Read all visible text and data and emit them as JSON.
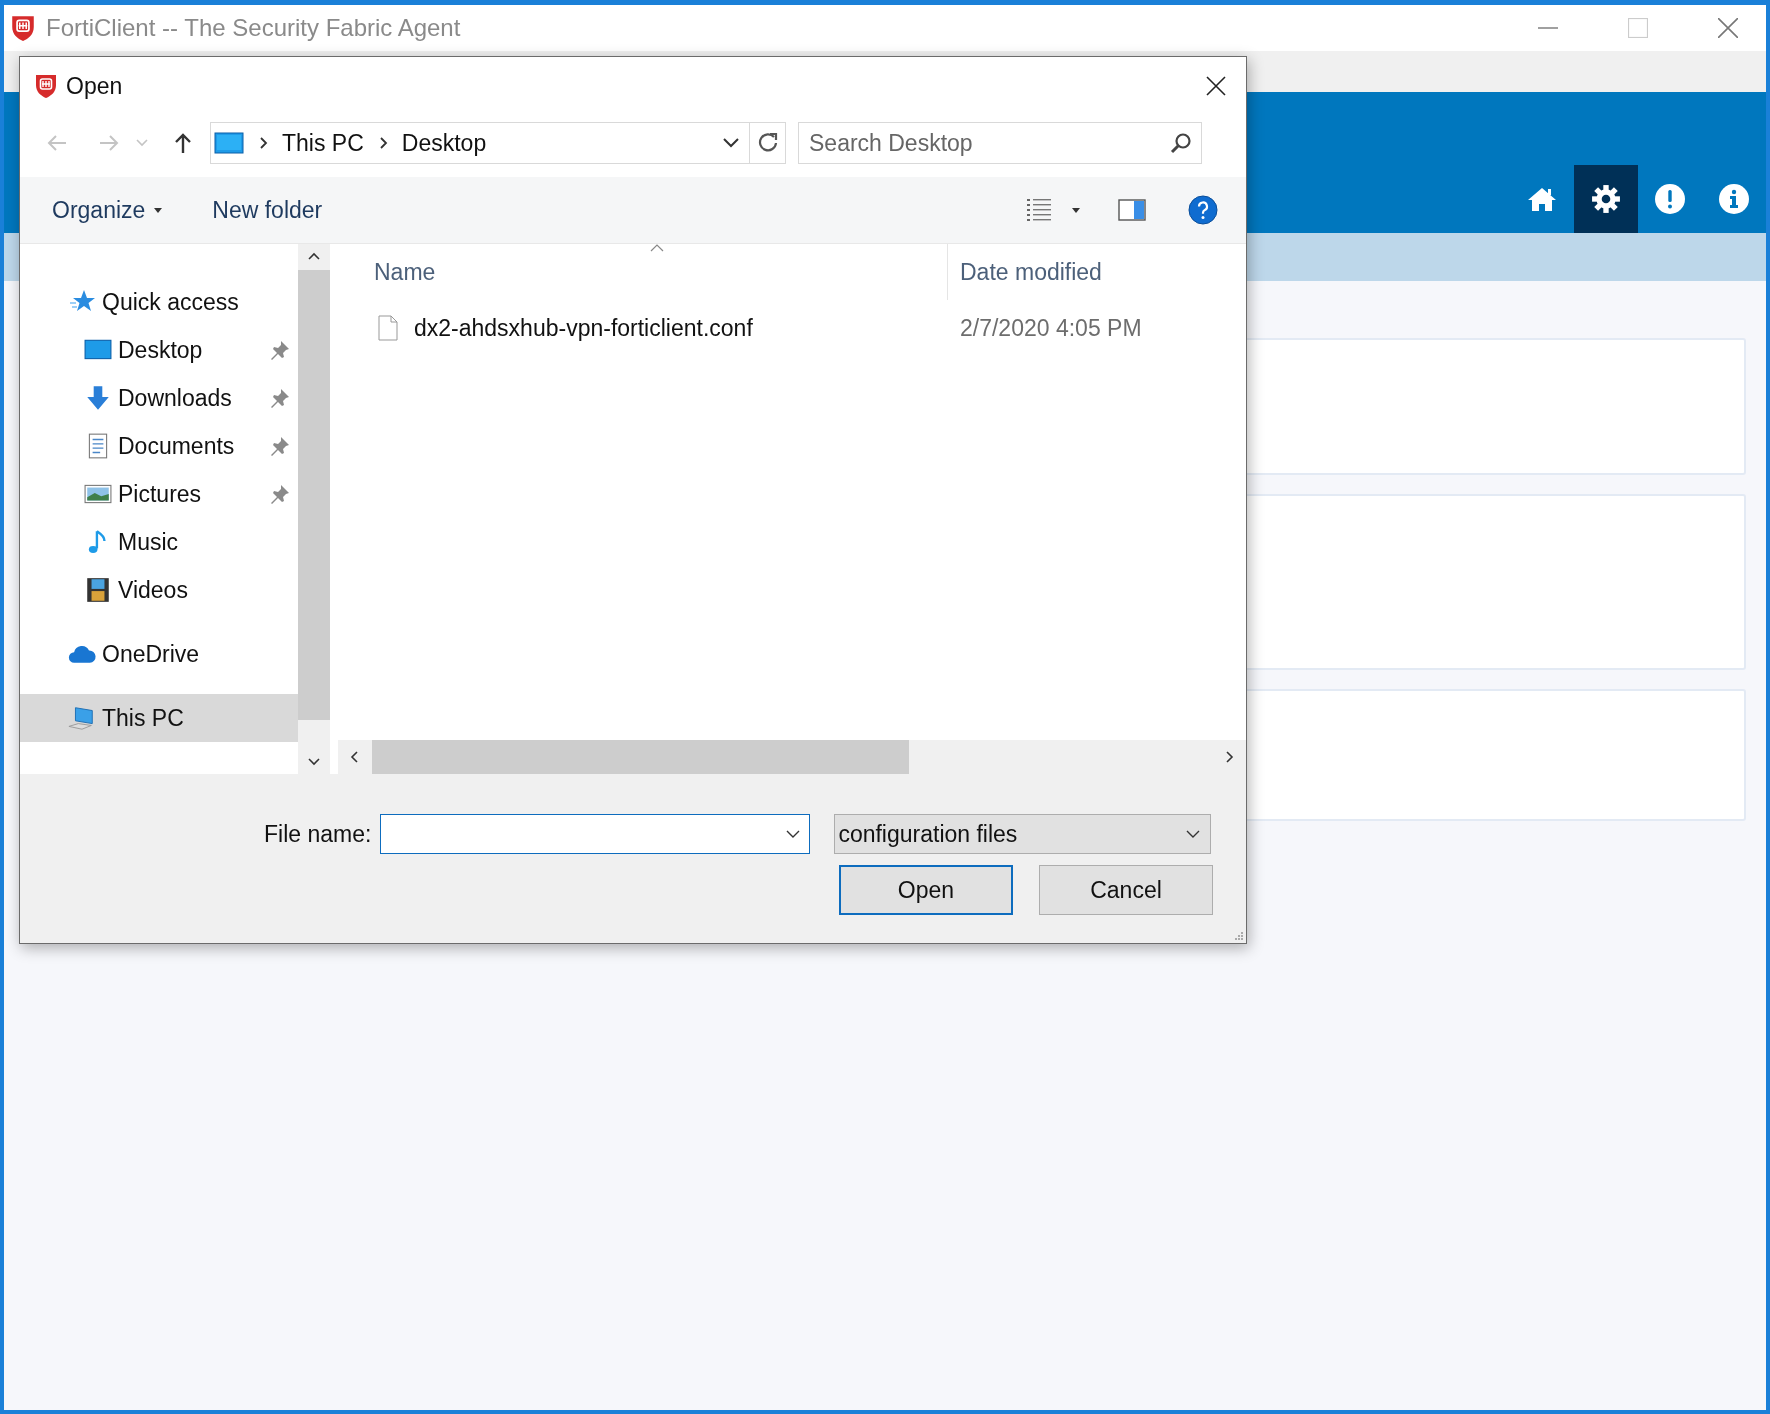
{
  "app": {
    "title": "FortiClient -- The Security Fabric Agent",
    "header_buttons": [
      {
        "selected": false
      },
      {
        "selected": true
      },
      {
        "selected": false
      },
      {
        "selected": false
      }
    ]
  },
  "dialog": {
    "title": "Open",
    "history_buttons": [
      {
        "disabled": true
      },
      {
        "disabled": true
      },
      {
        "disabled": false
      }
    ],
    "breadcrumb": [
      "This PC",
      "Desktop"
    ],
    "search": {
      "placeholder": "Search Desktop"
    },
    "toolbar": [
      {
        "label": "Organize",
        "has_menu": true
      },
      {
        "label": "New folder",
        "has_menu": false
      }
    ],
    "nav_pane": [
      {
        "label": "Quick access",
        "selected": false,
        "children": [
          {
            "label": "Desktop",
            "selected": false,
            "pinned": true
          },
          {
            "label": "Downloads",
            "selected": false,
            "pinned": true
          },
          {
            "label": "Documents",
            "selected": false,
            "pinned": true
          },
          {
            "label": "Pictures",
            "selected": false,
            "pinned": true
          },
          {
            "label": "Music",
            "selected": false,
            "pinned": false
          },
          {
            "label": "Videos",
            "selected": false,
            "pinned": false
          }
        ]
      },
      {
        "label": "OneDrive",
        "selected": false
      },
      {
        "label": "This PC",
        "selected": true
      }
    ],
    "columns": [
      "Name",
      "Date modified"
    ],
    "files": [
      {
        "name": "dx2-ahdsxhub-vpn-forticlient.conf",
        "date_modified": "2/7/2020 4:05 PM"
      }
    ],
    "file_name_label": "File name:",
    "file_type": "configuration files",
    "buttons": [
      {
        "label": "Open",
        "default": true
      },
      {
        "label": "Cancel",
        "default": false
      }
    ]
  }
}
